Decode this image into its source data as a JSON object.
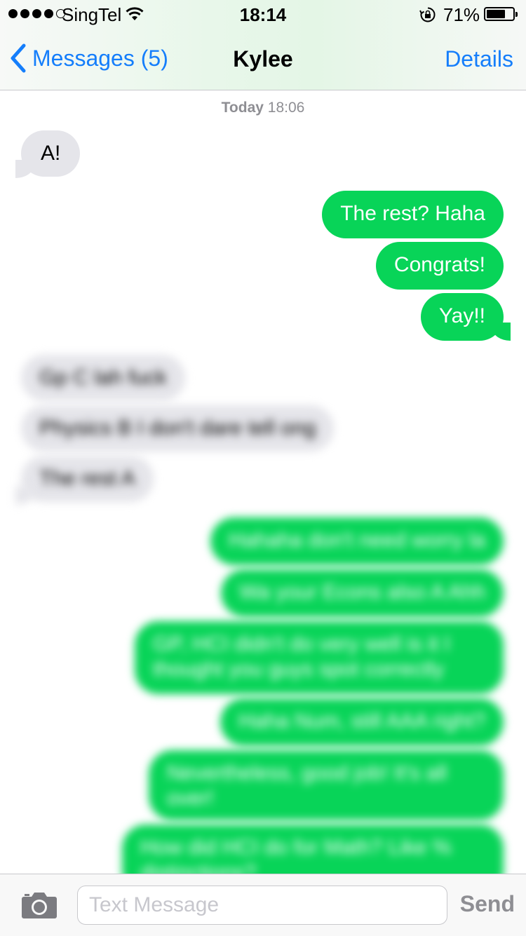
{
  "status_bar": {
    "carrier": "SingTel",
    "time": "18:14",
    "battery_percent": "71%",
    "battery_level": 0.71,
    "signal_bars": 4
  },
  "nav": {
    "back_label": "Messages (5)",
    "title": "Kylee",
    "details_label": "Details"
  },
  "timestamp": {
    "day": "Today",
    "time": "18:06"
  },
  "messages": [
    {
      "from": "them",
      "text": "A!"
    },
    {
      "from": "me",
      "text": "The rest? Haha"
    },
    {
      "from": "me",
      "text": "Congrats!"
    },
    {
      "from": "me",
      "text": "Yay!!"
    },
    {
      "from": "them",
      "text": "Gp C lah fuck"
    },
    {
      "from": "them",
      "text": "Physics B I don't dare tell ong"
    },
    {
      "from": "them",
      "text": "The rest A"
    },
    {
      "from": "me",
      "text": "Hahaha don't need worry la"
    },
    {
      "from": "me",
      "text": "Wa your Econs also A Ahh"
    },
    {
      "from": "me",
      "text": "GP, HCI didn't do very well is it I thought you guys spot correctly"
    },
    {
      "from": "me",
      "text": "Haha Num, still AAA right?"
    },
    {
      "from": "me",
      "text": "Nevertheless, good job! It's all over!"
    },
    {
      "from": "me",
      "text": "How did HCI do for Math? Like % distinctions?"
    }
  ],
  "input": {
    "placeholder": "Text Message",
    "send_label": "Send"
  },
  "colors": {
    "accent": "#157efb",
    "outgoing_bubble": "#08d458",
    "incoming_bubble": "#e5e5ea"
  }
}
